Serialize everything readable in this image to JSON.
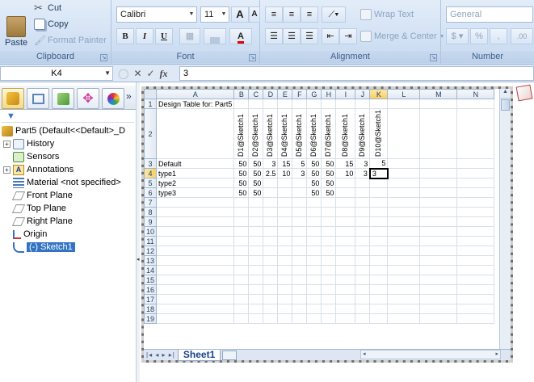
{
  "ribbon": {
    "clipboard": {
      "label": "Clipboard",
      "paste": "Paste",
      "cut": "Cut",
      "copy": "Copy",
      "format_painter": "Format Painter"
    },
    "font": {
      "label": "Font",
      "font_name": "Calibri",
      "font_size": "11",
      "grow": "A",
      "shrink": "A",
      "bold": "B",
      "italic": "I",
      "underline": "U",
      "font_color": "A"
    },
    "alignment": {
      "label": "Alignment",
      "wrap_text": "Wrap Text",
      "merge_center": "Merge & Center"
    },
    "number": {
      "label": "Number",
      "format": "General",
      "currency": "$",
      "percent": "%",
      "comma": ",",
      "increase_decimal": ".00"
    }
  },
  "formula_bar": {
    "name_box": "K4",
    "fx": "fx",
    "value": "3"
  },
  "feature_manager": {
    "root": "Part5  (Default<<Default>_D",
    "items": [
      {
        "label": "History",
        "expandable": true
      },
      {
        "label": "Sensors",
        "expandable": false
      },
      {
        "label": "Annotations",
        "expandable": true
      },
      {
        "label": "Material <not specified>",
        "expandable": false
      },
      {
        "label": "Front Plane",
        "expandable": false
      },
      {
        "label": "Top Plane",
        "expandable": false
      },
      {
        "label": "Right Plane",
        "expandable": false
      },
      {
        "label": "Origin",
        "expandable": false
      },
      {
        "label": "(-) Sketch1",
        "expandable": false,
        "selected": true
      }
    ],
    "more": "»"
  },
  "sheet": {
    "columns": [
      "A",
      "B",
      "C",
      "D",
      "E",
      "F",
      "G",
      "H",
      "I",
      "J",
      "K",
      "L",
      "M",
      "N"
    ],
    "selected_column": "K",
    "selected_row": 4,
    "title": "Design Table for: Part5",
    "headers": [
      "D1@Sketch1",
      "D2@Sketch1",
      "D3@Sketch1",
      "D4@Sketch1",
      "D5@Sketch1",
      "D6@Sketch1",
      "D7@Sketch1",
      "D8@Sketch1",
      "D9@Sketch1",
      "D10@Sketch1"
    ],
    "rows": [
      {
        "name": "Default",
        "values": [
          "50",
          "50",
          "3",
          "15",
          "5",
          "50",
          "50",
          "15",
          "3",
          "5"
        ]
      },
      {
        "name": "type1",
        "values": [
          "50",
          "50",
          "2.5",
          "10",
          "3",
          "50",
          "50",
          "10",
          "3",
          "3"
        ]
      },
      {
        "name": "type2",
        "values": [
          "50",
          "50",
          "",
          "",
          "",
          "50",
          "50",
          "",
          "",
          ""
        ]
      },
      {
        "name": "type3",
        "values": [
          "50",
          "50",
          "",
          "",
          "",
          "50",
          "50",
          "",
          "",
          ""
        ]
      }
    ],
    "row_count": 19,
    "tab_name": "Sheet1"
  }
}
